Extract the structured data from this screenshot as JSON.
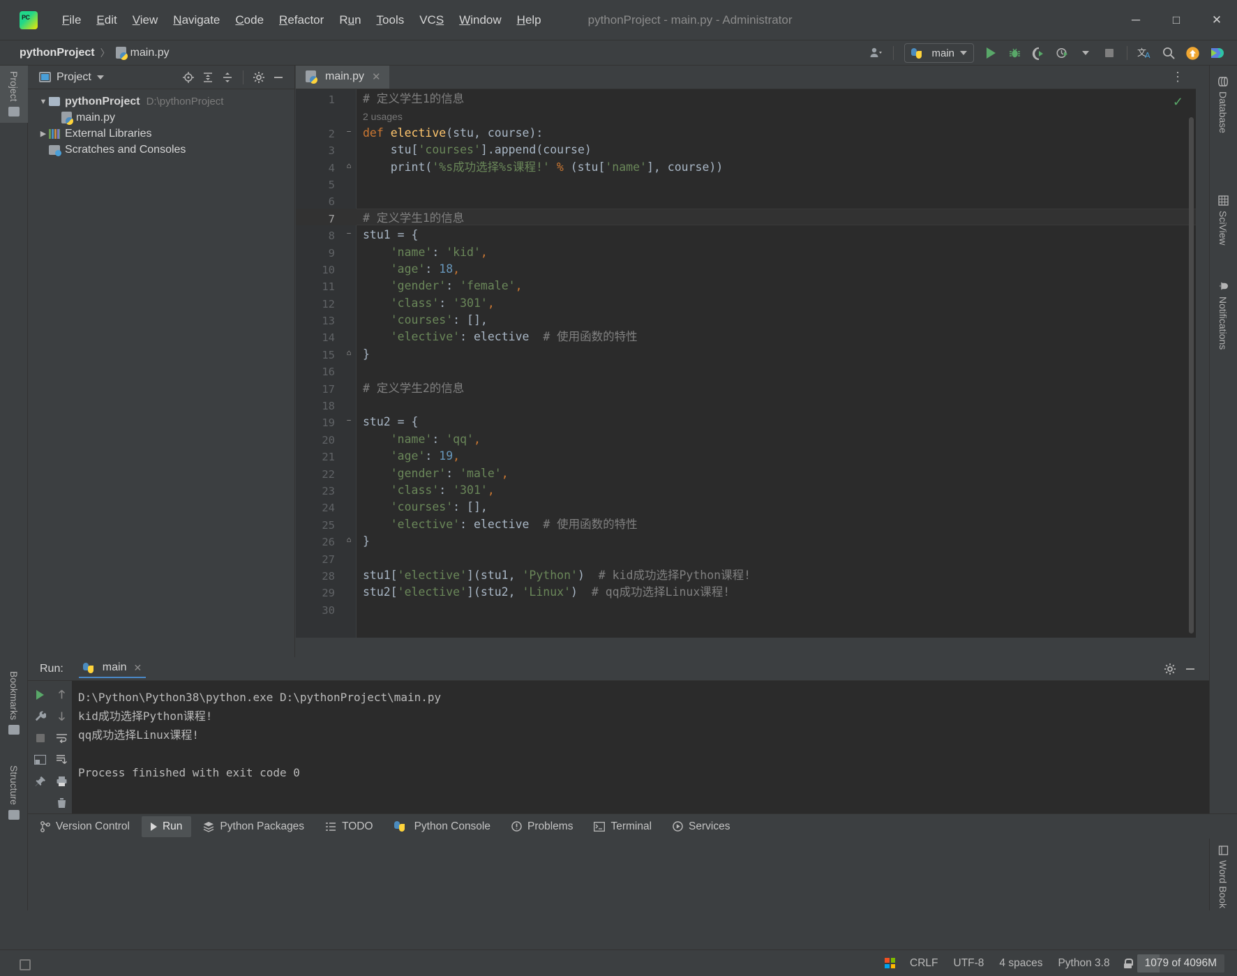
{
  "window": {
    "title": "pythonProject - main.py - Administrator",
    "controls": {
      "minimize": "─",
      "maximize": "□",
      "close": "✕"
    }
  },
  "menu": {
    "items": [
      {
        "label": "File",
        "mnemonic": "F"
      },
      {
        "label": "Edit",
        "mnemonic": "E"
      },
      {
        "label": "View",
        "mnemonic": "V"
      },
      {
        "label": "Navigate",
        "mnemonic": "N"
      },
      {
        "label": "Code",
        "mnemonic": "C"
      },
      {
        "label": "Refactor",
        "mnemonic": "R"
      },
      {
        "label": "Run",
        "mnemonic": "u"
      },
      {
        "label": "Tools",
        "mnemonic": "T"
      },
      {
        "label": "VCS",
        "mnemonic": "S"
      },
      {
        "label": "Window",
        "mnemonic": "W"
      },
      {
        "label": "Help",
        "mnemonic": "H"
      }
    ]
  },
  "navbar": {
    "breadcrumb": {
      "project": "pythonProject",
      "separator": "〉",
      "file": "main.py"
    },
    "run_config": {
      "label": "main"
    },
    "actions": [
      "account-icon",
      "run-button",
      "debug-button",
      "run-coverage-button",
      "profile-button",
      "stop-button",
      "translate-icon",
      "search-icon",
      "update-badge-icon",
      "ide-services-icon"
    ]
  },
  "left_strip": {
    "tabs": [
      {
        "label": "Project",
        "icon": "folder-icon",
        "active": true
      },
      {
        "label": "Bookmarks",
        "icon": "bookmark-icon",
        "active": false
      },
      {
        "label": "Structure",
        "icon": "structure-icon",
        "active": false
      }
    ]
  },
  "right_strip": {
    "tabs": [
      {
        "label": "Database",
        "icon": "database-icon"
      },
      {
        "label": "SciView",
        "icon": "grid-icon"
      },
      {
        "label": "Notifications",
        "icon": "bell-icon"
      },
      {
        "label": "Word Book",
        "icon": "book-icon"
      }
    ]
  },
  "project_panel": {
    "title": "Project",
    "header_actions": [
      "locate-icon",
      "expand-all-icon",
      "collapse-all-icon",
      "settings-gear-icon",
      "hide-icon"
    ],
    "tree": [
      {
        "name": "pythonProject",
        "path": "D:\\pythonProject",
        "icon": "folder-icon",
        "expanded": true,
        "depth": 0,
        "bold": true
      },
      {
        "name": "main.py",
        "path": "",
        "icon": "python-file-icon",
        "expanded": null,
        "depth": 1,
        "bold": false
      },
      {
        "name": "External Libraries",
        "path": "",
        "icon": "libraries-icon",
        "expanded": false,
        "depth": 0,
        "bold": false
      },
      {
        "name": "Scratches and Consoles",
        "path": "",
        "icon": "scratches-icon",
        "expanded": null,
        "depth": 0,
        "bold": false
      }
    ]
  },
  "editor": {
    "tabs": [
      {
        "label": "main.py",
        "icon": "python-file-icon",
        "active": true,
        "close": "✕"
      }
    ],
    "inspection_status": "✓",
    "options_icon": "more-options-icon",
    "usages_hint": {
      "line": 2,
      "text": "2 usages"
    },
    "current_line": 7,
    "lines": [
      {
        "n": 1,
        "fold": "",
        "tokens": [
          {
            "t": "# 定义学生1的信息",
            "c": "cmt"
          }
        ]
      },
      {
        "n": 2,
        "fold": "−",
        "tokens": [
          {
            "t": "def ",
            "c": "kw"
          },
          {
            "t": "elective",
            "c": "fn"
          },
          {
            "t": "(stu, course):",
            "c": "pun"
          }
        ]
      },
      {
        "n": 3,
        "fold": "",
        "tokens": [
          {
            "t": "    stu[",
            "c": "var"
          },
          {
            "t": "'courses'",
            "c": "str"
          },
          {
            "t": "].append(course)",
            "c": "var"
          }
        ]
      },
      {
        "n": 4,
        "fold": "⌂",
        "tokens": [
          {
            "t": "    print(",
            "c": "var"
          },
          {
            "t": "'%s成功选择%s课程!'",
            "c": "str"
          },
          {
            "t": " % ",
            "c": "orng"
          },
          {
            "t": "(stu[",
            "c": "var"
          },
          {
            "t": "'name'",
            "c": "str"
          },
          {
            "t": "], course))",
            "c": "var"
          }
        ]
      },
      {
        "n": 5,
        "fold": "",
        "tokens": []
      },
      {
        "n": 6,
        "fold": "",
        "tokens": []
      },
      {
        "n": 7,
        "fold": "",
        "tokens": [
          {
            "t": "# 定义学生1的信息",
            "c": "cmt"
          }
        ]
      },
      {
        "n": 8,
        "fold": "−",
        "tokens": [
          {
            "t": "stu1 = {",
            "c": "var"
          }
        ]
      },
      {
        "n": 9,
        "fold": "",
        "tokens": [
          {
            "t": "    ",
            "c": "var"
          },
          {
            "t": "'name'",
            "c": "str"
          },
          {
            "t": ": ",
            "c": "var"
          },
          {
            "t": "'kid'",
            "c": "str"
          },
          {
            "t": ",",
            "c": "orng"
          }
        ]
      },
      {
        "n": 10,
        "fold": "",
        "tokens": [
          {
            "t": "    ",
            "c": "var"
          },
          {
            "t": "'age'",
            "c": "str"
          },
          {
            "t": ": ",
            "c": "var"
          },
          {
            "t": "18",
            "c": "num"
          },
          {
            "t": ",",
            "c": "orng"
          }
        ]
      },
      {
        "n": 11,
        "fold": "",
        "tokens": [
          {
            "t": "    ",
            "c": "var"
          },
          {
            "t": "'gender'",
            "c": "str"
          },
          {
            "t": ": ",
            "c": "var"
          },
          {
            "t": "'female'",
            "c": "str"
          },
          {
            "t": ",",
            "c": "orng"
          }
        ]
      },
      {
        "n": 12,
        "fold": "",
        "tokens": [
          {
            "t": "    ",
            "c": "var"
          },
          {
            "t": "'class'",
            "c": "str"
          },
          {
            "t": ": ",
            "c": "var"
          },
          {
            "t": "'301'",
            "c": "str"
          },
          {
            "t": ",",
            "c": "orng"
          }
        ]
      },
      {
        "n": 13,
        "fold": "",
        "tokens": [
          {
            "t": "    ",
            "c": "var"
          },
          {
            "t": "'courses'",
            "c": "str"
          },
          {
            "t": ": [],",
            "c": "var"
          }
        ]
      },
      {
        "n": 14,
        "fold": "",
        "tokens": [
          {
            "t": "    ",
            "c": "var"
          },
          {
            "t": "'elective'",
            "c": "str"
          },
          {
            "t": ": elective  ",
            "c": "var"
          },
          {
            "t": "# 使用函数的特性",
            "c": "cmt"
          }
        ]
      },
      {
        "n": 15,
        "fold": "⌂",
        "tokens": [
          {
            "t": "}",
            "c": "var"
          }
        ]
      },
      {
        "n": 16,
        "fold": "",
        "tokens": []
      },
      {
        "n": 17,
        "fold": "",
        "tokens": [
          {
            "t": "# 定义学生2的信息",
            "c": "cmt"
          }
        ]
      },
      {
        "n": 18,
        "fold": "",
        "tokens": []
      },
      {
        "n": 19,
        "fold": "−",
        "tokens": [
          {
            "t": "stu2 = {",
            "c": "var"
          }
        ]
      },
      {
        "n": 20,
        "fold": "",
        "tokens": [
          {
            "t": "    ",
            "c": "var"
          },
          {
            "t": "'name'",
            "c": "str"
          },
          {
            "t": ": ",
            "c": "var"
          },
          {
            "t": "'qq'",
            "c": "str"
          },
          {
            "t": ",",
            "c": "orng"
          }
        ]
      },
      {
        "n": 21,
        "fold": "",
        "tokens": [
          {
            "t": "    ",
            "c": "var"
          },
          {
            "t": "'age'",
            "c": "str"
          },
          {
            "t": ": ",
            "c": "var"
          },
          {
            "t": "19",
            "c": "num"
          },
          {
            "t": ",",
            "c": "orng"
          }
        ]
      },
      {
        "n": 22,
        "fold": "",
        "tokens": [
          {
            "t": "    ",
            "c": "var"
          },
          {
            "t": "'gender'",
            "c": "str"
          },
          {
            "t": ": ",
            "c": "var"
          },
          {
            "t": "'male'",
            "c": "str"
          },
          {
            "t": ",",
            "c": "orng"
          }
        ]
      },
      {
        "n": 23,
        "fold": "",
        "tokens": [
          {
            "t": "    ",
            "c": "var"
          },
          {
            "t": "'class'",
            "c": "str"
          },
          {
            "t": ": ",
            "c": "var"
          },
          {
            "t": "'301'",
            "c": "str"
          },
          {
            "t": ",",
            "c": "orng"
          }
        ]
      },
      {
        "n": 24,
        "fold": "",
        "tokens": [
          {
            "t": "    ",
            "c": "var"
          },
          {
            "t": "'courses'",
            "c": "str"
          },
          {
            "t": ": [],",
            "c": "var"
          }
        ]
      },
      {
        "n": 25,
        "fold": "",
        "tokens": [
          {
            "t": "    ",
            "c": "var"
          },
          {
            "t": "'elective'",
            "c": "str"
          },
          {
            "t": ": elective  ",
            "c": "var"
          },
          {
            "t": "# 使用函数的特性",
            "c": "cmt"
          }
        ]
      },
      {
        "n": 26,
        "fold": "⌂",
        "tokens": [
          {
            "t": "}",
            "c": "var"
          }
        ]
      },
      {
        "n": 27,
        "fold": "",
        "tokens": []
      },
      {
        "n": 28,
        "fold": "",
        "tokens": [
          {
            "t": "stu1[",
            "c": "var"
          },
          {
            "t": "'elective'",
            "c": "str"
          },
          {
            "t": "](stu1, ",
            "c": "var"
          },
          {
            "t": "'Python'",
            "c": "str"
          },
          {
            "t": ")  ",
            "c": "var"
          },
          {
            "t": "# kid成功选择Python课程!",
            "c": "cmt"
          }
        ]
      },
      {
        "n": 29,
        "fold": "",
        "tokens": [
          {
            "t": "stu2[",
            "c": "var"
          },
          {
            "t": "'elective'",
            "c": "str"
          },
          {
            "t": "](stu2, ",
            "c": "var"
          },
          {
            "t": "'Linux'",
            "c": "str"
          },
          {
            "t": ")  ",
            "c": "var"
          },
          {
            "t": "# qq成功选择Linux课程!",
            "c": "cmt"
          }
        ]
      },
      {
        "n": 30,
        "fold": "",
        "tokens": []
      }
    ]
  },
  "run_panel": {
    "label": "Run:",
    "tab": {
      "label": "main",
      "icon": "python-icon",
      "close": "✕"
    },
    "header_actions": [
      "settings-gear-icon",
      "hide-icon"
    ],
    "gutter_actions": [
      "rerun-button",
      "stop-button",
      "wrap-text-button",
      "print-button",
      "pin-button",
      "scroll-up-button",
      "scroll-down-button",
      "soft-wrap-button",
      "clear-all-button"
    ],
    "console": [
      "D:\\Python\\Python38\\python.exe D:\\pythonProject\\main.py",
      "kid成功选择Python课程!",
      "qq成功选择Linux课程!",
      "",
      "Process finished with exit code 0"
    ]
  },
  "bottom_bar": {
    "items": [
      {
        "label": "Version Control",
        "icon": "branch-icon",
        "active": false
      },
      {
        "label": "Run",
        "icon": "play-icon",
        "active": true
      },
      {
        "label": "Python Packages",
        "icon": "packages-icon",
        "active": false
      },
      {
        "label": "TODO",
        "icon": "list-icon",
        "active": false
      },
      {
        "label": "Python Console",
        "icon": "python-icon",
        "active": false
      },
      {
        "label": "Problems",
        "icon": "error-icon",
        "active": false
      },
      {
        "label": "Terminal",
        "icon": "terminal-icon",
        "active": false
      },
      {
        "label": "Services",
        "icon": "services-icon",
        "active": false
      }
    ]
  },
  "status_bar": {
    "os_icon": "windows-logo-icon",
    "line_separator": "CRLF",
    "encoding": "UTF-8",
    "indent": "4 spaces",
    "interpreter": "Python 3.8",
    "lock_icon": "unlocked-icon",
    "memory": "1079 of 4096M",
    "memory_percent": 26
  },
  "colors": {
    "accent_green": "#59a869",
    "accent_blue": "#4a88c7",
    "editor_bg": "#2b2b2b",
    "panel_bg": "#3c3f41",
    "gutter_bg": "#313335",
    "string": "#6a8759",
    "keyword": "#cc7832",
    "number": "#6897bb",
    "comment": "#808080",
    "function": "#ffc66d",
    "text": "#a9b7c6"
  }
}
